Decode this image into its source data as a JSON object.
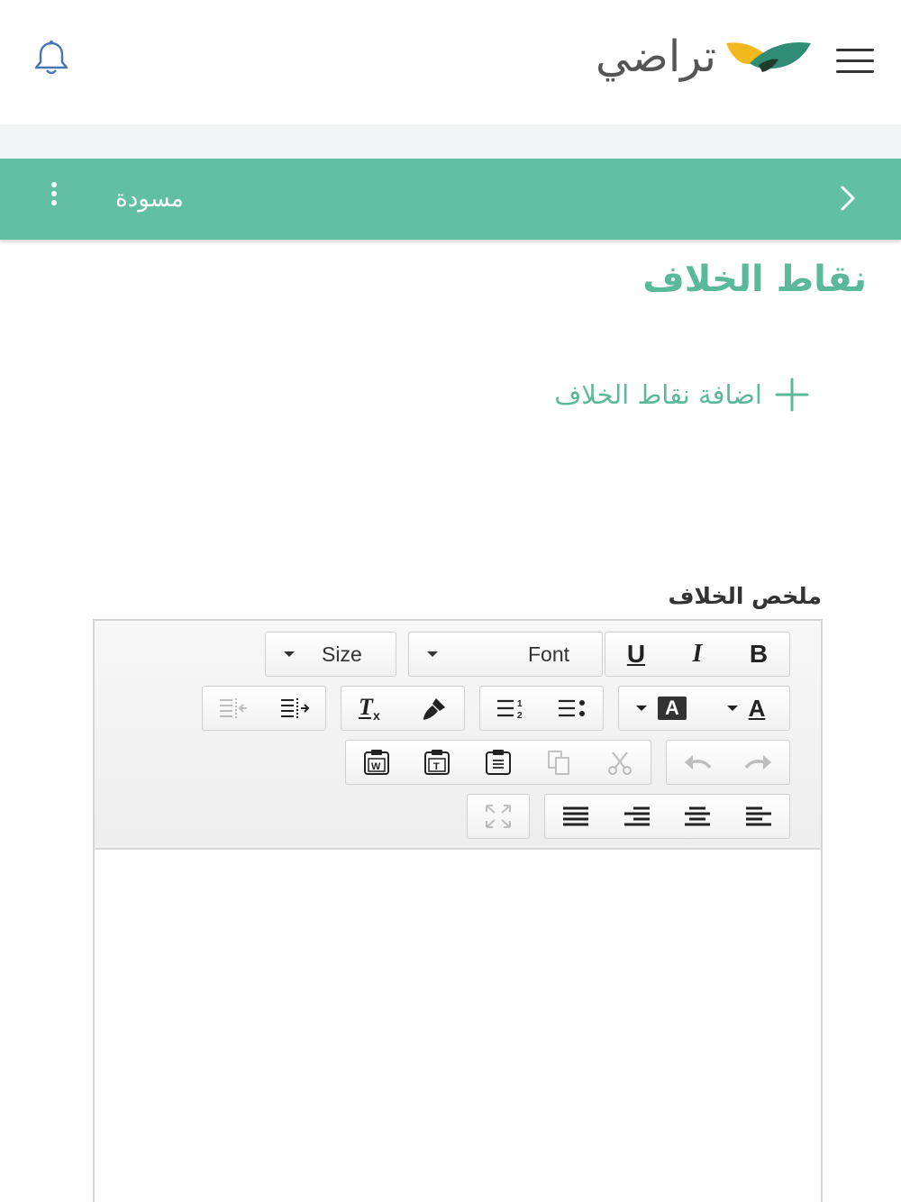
{
  "header": {
    "brand_text": "تراضي",
    "menu_icon": "hamburger-icon",
    "notification_icon": "bell-icon",
    "logo_colors": [
      "#f2b81e",
      "#2e8d74",
      "#1f3b2e"
    ]
  },
  "status_bar": {
    "label": "مسودة",
    "background": "#62c0a2",
    "back_icon": "chevron-right-icon",
    "more_icon": "kebab-icon"
  },
  "section": {
    "title": "نقاط الخلاف",
    "add_link": "اضافة نقاط الخلاف",
    "accent": "#5bb99b"
  },
  "editor": {
    "label": "ملخص الخلاف",
    "font_combo_label": "Font",
    "size_combo_label": "Size",
    "buttons": {
      "bold": "B",
      "italic": "I",
      "underline": "U",
      "text_color": "A",
      "bg_color": "A"
    },
    "content": ""
  }
}
